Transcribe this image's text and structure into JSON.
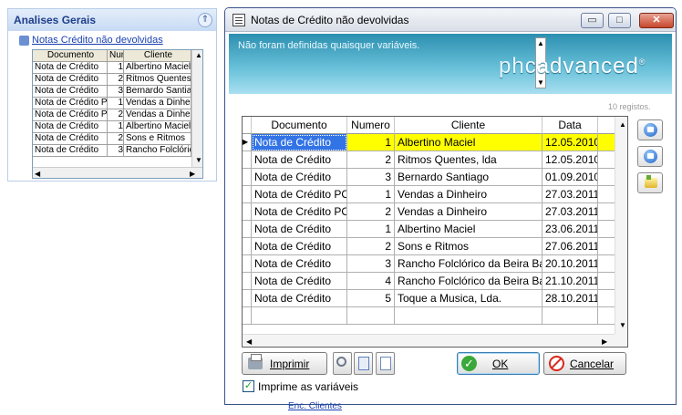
{
  "left_panel": {
    "title": "Analises Gerais",
    "collapse_glyph": "⇑",
    "link": "Notas Crédito não devolvidas",
    "mini_grid": {
      "columns": [
        "Documento",
        "Num",
        "Cliente"
      ],
      "rows": [
        [
          "Nota de Crédito",
          "1",
          "Albertino Maciel"
        ],
        [
          "Nota de Crédito",
          "2",
          "Ritmos Quentes, lda"
        ],
        [
          "Nota de Crédito",
          "3",
          "Bernardo Santiago"
        ],
        [
          "Nota de Crédito POS",
          "1",
          "Vendas a Dinheiro"
        ],
        [
          "Nota de Crédito POS",
          "2",
          "Vendas a Dinheiro"
        ],
        [
          "Nota de Crédito",
          "1",
          "Albertino Maciel"
        ],
        [
          "Nota de Crédito",
          "2",
          "Sons e Ritmos"
        ],
        [
          "Nota de Crédito",
          "3",
          "Rancho Folclórico"
        ]
      ]
    }
  },
  "dialog": {
    "title": "Notas de Crédito não devolvidas",
    "window_buttons": {
      "minimize": "▭",
      "maximize": "□",
      "close": "✕"
    },
    "banner": {
      "message": "Não foram definidas quaisquer variáveis.",
      "logo_left": "phc",
      "logo_right": "advanced",
      "logo_mark": "®"
    },
    "record_count": "10 registos.",
    "grid": {
      "columns": {
        "documento": "Documento",
        "numero": "Numero",
        "cliente": "Cliente",
        "data": "Data"
      },
      "rows": [
        {
          "documento": "Nota de Crédito",
          "numero": "1",
          "cliente": "Albertino Maciel",
          "data": "12.05.2010"
        },
        {
          "documento": "Nota de Crédito",
          "numero": "2",
          "cliente": "Ritmos Quentes, lda",
          "data": "12.05.2010"
        },
        {
          "documento": "Nota de Crédito",
          "numero": "3",
          "cliente": "Bernardo Santiago",
          "data": "01.09.2010"
        },
        {
          "documento": "Nota de Crédito POS",
          "numero": "1",
          "cliente": "Vendas a Dinheiro",
          "data": "27.03.2011"
        },
        {
          "documento": "Nota de Crédito POS",
          "numero": "2",
          "cliente": "Vendas a Dinheiro",
          "data": "27.03.2011"
        },
        {
          "documento": "Nota de Crédito",
          "numero": "1",
          "cliente": "Albertino Maciel",
          "data": "23.06.2011"
        },
        {
          "documento": "Nota de Crédito",
          "numero": "2",
          "cliente": "Sons e Ritmos",
          "data": "27.06.2011"
        },
        {
          "documento": "Nota de Crédito",
          "numero": "3",
          "cliente": "Rancho Folclórico da Beira Baixa",
          "data": "20.10.2011"
        },
        {
          "documento": "Nota de Crédito",
          "numero": "4",
          "cliente": "Rancho Folclórico da Beira Baixa",
          "data": "21.10.2011"
        },
        {
          "documento": "Nota de Crédito",
          "numero": "5",
          "cliente": "Toque a Musica, Lda.",
          "data": "28.10.2011"
        }
      ],
      "selected_row": 0,
      "current_row_marker": "▶"
    },
    "buttons": {
      "print": "Imprimir",
      "ok": "OK",
      "ok_check": "✓",
      "cancel": "Cancelar"
    },
    "checkbox": {
      "label": "Imprime as variáveis",
      "checked": true,
      "mark": "✓"
    }
  },
  "background_peek": "Enc. Clientes",
  "colors": {
    "selection_yellow": "#ffff00",
    "selection_blue": "#3273e6",
    "banner_teal": "#2c8fb0",
    "close_red": "#c8462d"
  }
}
